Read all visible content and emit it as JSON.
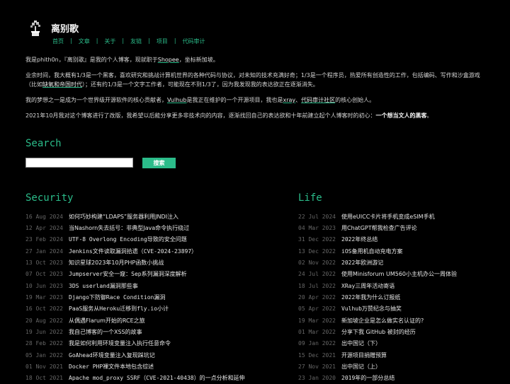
{
  "site": {
    "title": "离别歌",
    "nav": [
      "首页",
      "文章",
      "关于",
      "友链",
      "项目",
      "代码审计"
    ]
  },
  "intro": {
    "p1_a": "我是phith0n，『离别歌』是我的个人博客，现就职于",
    "p1_link": "Shopee",
    "p1_b": "，坐标新加坡。",
    "p2_a": "业余时间，我大概有1/3是一个黑客，喜欢研究和挑战计算机世界的各种代码与协议，对未知的技术充满好奇；1/3是一个程序员，热爱所有创造性的工作，包括编码、写作和沙盒游戏（比如",
    "p2_link": "缺氧和帝国时代",
    "p2_b": "）；还有约1/3是一个文字工作者，可能现在不到1/3了，因为我发现我的表达欲正在逐渐消失。",
    "p3_a": "我的梦想之一是成为一个世界级开源软件的核心贡献者，",
    "p3_link1": "Vulhub",
    "p3_b": "是我正在维护的一个开源项目，我也是",
    "p3_link2": "xray",
    "p3_c": "、",
    "p3_link3": "代码审计社区",
    "p3_d": "的核心创始人。",
    "p4_a": "2021年10月我对这个博客进行了改版，我希望以后能分享更多非技术向的内容，逐渐找回自己的表达欲和十年前建立起个人博客时的初心：",
    "p4_bold": "一个想当文人的黑客",
    "p4_b": "。"
  },
  "search": {
    "heading": "Search",
    "placeholder": "",
    "button": "搜索"
  },
  "security": {
    "heading": "Security",
    "posts": [
      {
        "date": "16 Aug 2024",
        "title": "如何巧妙构建“LDAPS”服务器利用JNDI注入"
      },
      {
        "date": "12 Apr 2024",
        "title": "当Nashorn失去括号：非典型Java命令执行绕过"
      },
      {
        "date": "23 Feb 2024",
        "title": "UTF-8 Overlong Encoding导致的安全问题"
      },
      {
        "date": "27 Jan 2024",
        "title": "Jenkins文件读取漏洞拾遗（CVE-2024-23897）"
      },
      {
        "date": "13 Oct 2023",
        "title": "知识星球2023年10月PHP函数小挑战"
      },
      {
        "date": "07 Oct 2023",
        "title": "Jumpserver安全一窥：Sep系列漏洞深度解析"
      },
      {
        "date": "10 Jun 2023",
        "title": "3DS userland漏洞那些事"
      },
      {
        "date": "19 Mar 2023",
        "title": "Django下防御Race Condition漏洞"
      },
      {
        "date": "16 Oct 2022",
        "title": "PaaS服务从Heroku迁移到fly.io小计"
      },
      {
        "date": "20 Aug 2022",
        "title": "从偶遇Flarum开始的RCE之旅"
      },
      {
        "date": "19 Jun 2022",
        "title": "我自己博客的一个XSS的故事"
      },
      {
        "date": "28 Feb 2022",
        "title": "我是如何利用环境变量注入执行任意命令"
      },
      {
        "date": "05 Jan 2022",
        "title": "GoAhead环境变量注入复现踩坑记"
      },
      {
        "date": "01 Nov 2021",
        "title": "Docker PHP裸文件本地包含综述"
      },
      {
        "date": "18 Oct 2021",
        "title": "Apache mod_proxy SSRF（CVE-2021-40438）的一点分析和延伸"
      }
    ]
  },
  "life": {
    "heading": "Life",
    "posts": [
      {
        "date": "22 Jul 2024",
        "title": "使用eUICC卡片将手机变成eSIM手机"
      },
      {
        "date": "04 Mar 2023",
        "title": "用ChatGPT帮我检查广告评论"
      },
      {
        "date": "31 Dec 2022",
        "title": "2022年终总结"
      },
      {
        "date": "13 Dec 2022",
        "title": "iOS备用机自动充电方案"
      },
      {
        "date": "02 Nov 2022",
        "title": "2022年欧洲游记"
      },
      {
        "date": "24 Jul 2022",
        "title": "使用Minisforum UM560小主机办公一周体验"
      },
      {
        "date": "18 Jul 2022",
        "title": "XRay三周年活动寄语"
      },
      {
        "date": "20 Apr 2022",
        "title": "2022年我为什么订报纸"
      },
      {
        "date": "05 Apr 2022",
        "title": "Vulhub万赞纪念与抽奖"
      },
      {
        "date": "19 Mar 2022",
        "title": "新加坡企业是怎么做实名认证的?"
      },
      {
        "date": "01 Mar 2022",
        "title": "分享下我 GitHub 被封的经历"
      },
      {
        "date": "09 Jan 2022",
        "title": "出中国记（下）"
      },
      {
        "date": "15 Dec 2021",
        "title": "开源项目捐赠预算"
      },
      {
        "date": "27 Nov 2021",
        "title": "出中国记（上）"
      },
      {
        "date": "23 Jan 2020",
        "title": "2019年的一部分总结"
      }
    ]
  },
  "colors": {
    "accent": "#2bbc8a",
    "background": "#000000"
  },
  "icons": {
    "logo": "bonsai-icon"
  }
}
